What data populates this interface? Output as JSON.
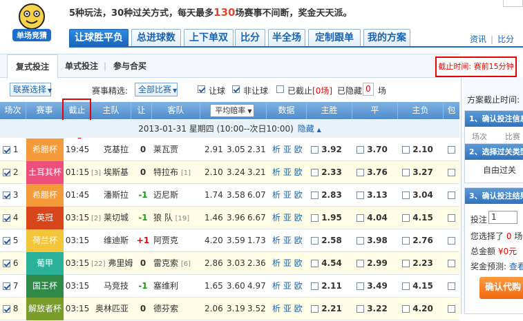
{
  "header": {
    "logo_text": "单场竞猜",
    "promo_pre": "5种玩法，30种过关方式，每天最多",
    "promo_num": "130",
    "promo_post": "场赛事不间断，奖金天天派。",
    "tabs": [
      "让球胜平负",
      "总进球数",
      "上下单双",
      "比分",
      "半全场",
      "定制跟单",
      "我的方案"
    ],
    "links": [
      "资讯",
      "比分"
    ]
  },
  "subtabs": [
    "复式投注",
    "单式投注",
    "参与合买"
  ],
  "deadline_notice": "截止时间: 赛前15分钟",
  "filter": {
    "league_select": "联赛选择",
    "filter_label": "赛事精选:",
    "all_matches": "全部比赛",
    "opt_handicap": "让球",
    "opt_nonhandicap": "非让球",
    "opt_closed": "已截止",
    "closed_count": "[0场]",
    "hidden_label": "已隐藏",
    "hidden_count": "0",
    "hidden_unit": "场"
  },
  "columns": {
    "match_no": "场次",
    "league": "赛事",
    "deadline": "截止",
    "home": "主队",
    "handicap": "让",
    "away": "客队",
    "avg_odds": "平均赔率",
    "data": "数据",
    "win": "主胜",
    "draw": "平",
    "loss": "主负",
    "pack": "包"
  },
  "date_row": {
    "text": "2013-01-31 星期四 (10:00--次日10:00)",
    "hide": "隐藏"
  },
  "data_links": [
    "析",
    "亚",
    "欧"
  ],
  "matches": [
    {
      "no": "1",
      "league": "希腊杯",
      "color": "#f49a3b",
      "time": "19:45",
      "home_rank": "",
      "home": "克基拉",
      "hcp": "0",
      "away": "莱瓦贾",
      "away_rank": "",
      "o1": "2.91",
      "o2": "3.05",
      "o3": "2.31",
      "win": "3.92",
      "draw": "3.70",
      "loss": "2.10"
    },
    {
      "no": "2",
      "league": "土耳其杯",
      "color": "#ee4e7a",
      "time": "01:15",
      "home_rank": "[3]",
      "home": "埃斯基",
      "hcp": "0",
      "away": "特拉布",
      "away_rank": "[1]",
      "o1": "2.10",
      "o2": "3.24",
      "o3": "3.21",
      "win": "2.33",
      "draw": "3.76",
      "loss": "3.27"
    },
    {
      "no": "3",
      "league": "希腊杯",
      "color": "#f49a3b",
      "time": "01:45",
      "home_rank": "",
      "home": "潘斯拉",
      "hcp": "-1",
      "away": "迈尼斯",
      "away_rank": "",
      "o1": "1.74",
      "o2": "3.58",
      "o3": "6.07",
      "win": "2.83",
      "draw": "3.13",
      "loss": "3.04"
    },
    {
      "no": "4",
      "league": "英冠",
      "color": "#d8471c",
      "time": "03:15",
      "home_rank": "[2]",
      "home": "莱切城",
      "hcp": "-1",
      "away": "狼 队",
      "away_rank": "[19]",
      "o1": "1.46",
      "o2": "3.96",
      "o3": "6.67",
      "win": "1.95",
      "draw": "4.04",
      "loss": "4.15"
    },
    {
      "no": "5",
      "league": "荷兰杯",
      "color": "#f3c53a",
      "time": "03:15",
      "home_rank": "",
      "home": "维迪斯",
      "hcp": "+1",
      "away": "阿贾克",
      "away_rank": "",
      "o1": "4.20",
      "o2": "3.59",
      "o3": "1.73",
      "win": "2.58",
      "draw": "3.98",
      "loss": "2.76"
    },
    {
      "no": "6",
      "league": "葡甲",
      "color": "#2bb09a",
      "time": "03:15",
      "home_rank": "[22]",
      "home": "弗里姆",
      "hcp": "0",
      "away": "雷克索",
      "away_rank": "[6]",
      "o1": "2.86",
      "o2": "3.03",
      "o3": "2.36",
      "win": "4.54",
      "draw": "2.99",
      "loss": "2.23"
    },
    {
      "no": "7",
      "league": "国王杯",
      "color": "#2f8a4a",
      "time": "03:15",
      "home_rank": "",
      "home": "马竞技",
      "hcp": "-1",
      "away": "塞维利",
      "away_rank": "",
      "o1": "1.65",
      "o2": "3.60",
      "o3": "4.97",
      "win": "2.11",
      "draw": "3.49",
      "loss": "4.15"
    },
    {
      "no": "8",
      "league": "解放者杯",
      "color": "#7a9c2a",
      "time": "03:15",
      "home_rank": "",
      "home": "奥林匹亚",
      "hcp": "0",
      "away": "德芬索",
      "away_rank": "",
      "o1": "2.06",
      "o2": "3.19",
      "o3": "3.52",
      "win": "2.21",
      "draw": "3.22",
      "loss": "4.20"
    }
  ],
  "side": {
    "plan_deadline": "方案截止时间:",
    "step1": "1、确认投注信息",
    "step1_cols": [
      "场次",
      "比赛"
    ],
    "step2": "2、选择过关类型",
    "free_pass": "自由过关",
    "step3": "3、确认投注结果",
    "bet_label": "投注",
    "bet_value": "1",
    "chosen_pre": "您选择了",
    "chosen_num": "0",
    "chosen_post": "场比",
    "total_label": "总金额",
    "total_value": "¥0元",
    "prize_label": "奖金预测:",
    "prize_link": "查看",
    "confirm": "确认代购"
  }
}
